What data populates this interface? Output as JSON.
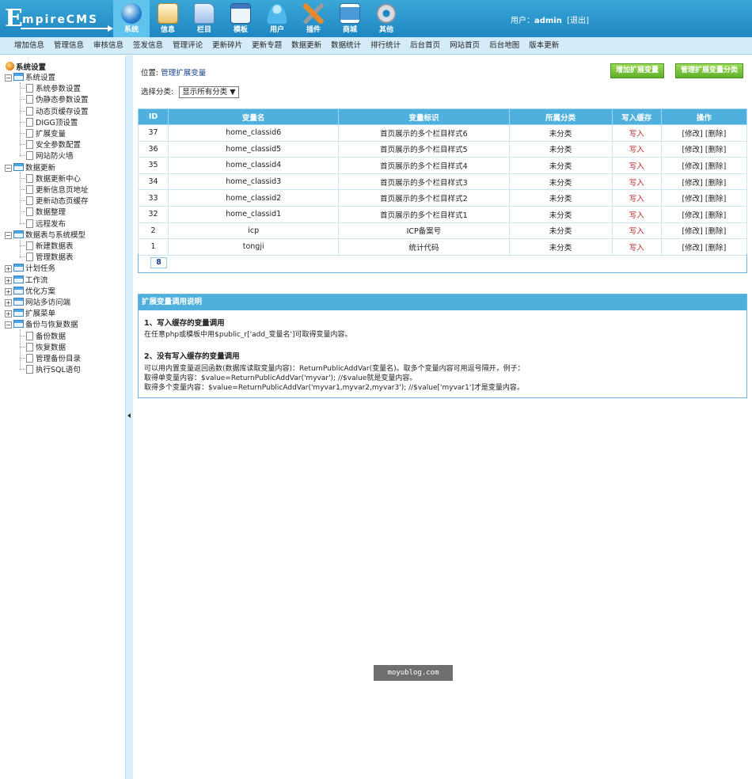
{
  "header": {
    "logo_big": "E",
    "logo_rest": "mpireCMS",
    "nav": [
      {
        "label": "系统",
        "icon": "globe-icon"
      },
      {
        "label": "信息",
        "icon": "notepad-icon"
      },
      {
        "label": "栏目",
        "icon": "folder-icon"
      },
      {
        "label": "模板",
        "icon": "window-icon"
      },
      {
        "label": "用户",
        "icon": "user-icon"
      },
      {
        "label": "插件",
        "icon": "tools-icon"
      },
      {
        "label": "商城",
        "icon": "shop-icon"
      },
      {
        "label": "其他",
        "icon": "gear-icon"
      }
    ],
    "user_label": "用户：",
    "user_name": "admin",
    "logout": "[退出]"
  },
  "subnav": [
    "增加信息",
    "管理信息",
    "审核信息",
    "签发信息",
    "管理评论",
    "更新碎片",
    "更新专题",
    "数据更新",
    "数据统计",
    "排行统计",
    "后台首页",
    "网站首页",
    "后台地图",
    "版本更新"
  ],
  "sidebar": {
    "root": "系统设置",
    "groups": [
      {
        "label": "系统设置",
        "open": true,
        "items": [
          "系统参数设置",
          "伪静态参数设置",
          "动态页缓存设置",
          "DIGG顶设置",
          "扩展变量",
          "安全参数配置",
          "网站防火墙"
        ]
      },
      {
        "label": "数据更新",
        "open": true,
        "items": [
          "数据更新中心",
          "更新信息页地址",
          "更新动态页缓存",
          "数据整理",
          "远程发布"
        ]
      },
      {
        "label": "数据表与系统模型",
        "open": true,
        "items": [
          "新建数据表",
          "管理数据表"
        ]
      },
      {
        "label": "计划任务",
        "open": false,
        "items": []
      },
      {
        "label": "工作流",
        "open": false,
        "items": []
      },
      {
        "label": "优化方案",
        "open": false,
        "items": []
      },
      {
        "label": "网站多访问端",
        "open": false,
        "items": []
      },
      {
        "label": "扩展菜单",
        "open": false,
        "items": []
      },
      {
        "label": "备份与恢复数据",
        "open": true,
        "items": [
          "备份数据",
          "恢复数据",
          "管理备份目录",
          "执行SQL语句"
        ]
      }
    ]
  },
  "main": {
    "location_label": "位置: ",
    "location_link": "管理扩展变量",
    "btn_add": "增加扩展变量",
    "btn_manage": "管理扩展变量分类",
    "filter_label": "选择分类:",
    "filter_value": "显示所有分类",
    "table": {
      "headers": [
        "ID",
        "变量名",
        "变量标识",
        "所属分类",
        "写入缓存",
        "操作"
      ],
      "rows": [
        {
          "id": "37",
          "name": "home_classid6",
          "mark": "首页展示的多个栏目样式6",
          "cat": "未分类",
          "cache": "写入",
          "edit": "[修改]",
          "del": "[删除]"
        },
        {
          "id": "36",
          "name": "home_classid5",
          "mark": "首页展示的多个栏目样式5",
          "cat": "未分类",
          "cache": "写入",
          "edit": "[修改]",
          "del": "[删除]"
        },
        {
          "id": "35",
          "name": "home_classid4",
          "mark": "首页展示的多个栏目样式4",
          "cat": "未分类",
          "cache": "写入",
          "edit": "[修改]",
          "del": "[删除]"
        },
        {
          "id": "34",
          "name": "home_classid3",
          "mark": "首页展示的多个栏目样式3",
          "cat": "未分类",
          "cache": "写入",
          "edit": "[修改]",
          "del": "[删除]"
        },
        {
          "id": "33",
          "name": "home_classid2",
          "mark": "首页展示的多个栏目样式2",
          "cat": "未分类",
          "cache": "写入",
          "edit": "[修改]",
          "del": "[删除]"
        },
        {
          "id": "32",
          "name": "home_classid1",
          "mark": "首页展示的多个栏目样式1",
          "cat": "未分类",
          "cache": "写入",
          "edit": "[修改]",
          "del": "[删除]"
        },
        {
          "id": "2",
          "name": "icp",
          "mark": "ICP备案号",
          "cat": "未分类",
          "cache": "写入",
          "edit": "[修改]",
          "del": "[删除]"
        },
        {
          "id": "1",
          "name": "tongji",
          "mark": "统计代码",
          "cat": "未分类",
          "cache": "写入",
          "edit": "[修改]",
          "del": "[删除]"
        }
      ],
      "pager": "8"
    },
    "help": {
      "title": "扩展变量调用说明",
      "h1": "1、写入缓存的变量调用",
      "p1": "在任意php或模板中用$public_r['add_变量名']可取得变量内容。",
      "h2": "2、没有写入缓存的变量调用",
      "p2": "可以用内置变量返回函数(数据库读取变量内容)：ReturnPublicAddVar(变量名)。取多个变量内容可用逗号隔开，例子：",
      "p3": "取得单变量内容：$value=ReturnPublicAddVar('myvar'); //$value就是变量内容。",
      "p4": "取得多个变量内容：$value=ReturnPublicAddVar('myvar1,myvar2,myvar3'); //$value['myvar1']才是变量内容。"
    }
  },
  "watermark": "moyublog.com"
}
